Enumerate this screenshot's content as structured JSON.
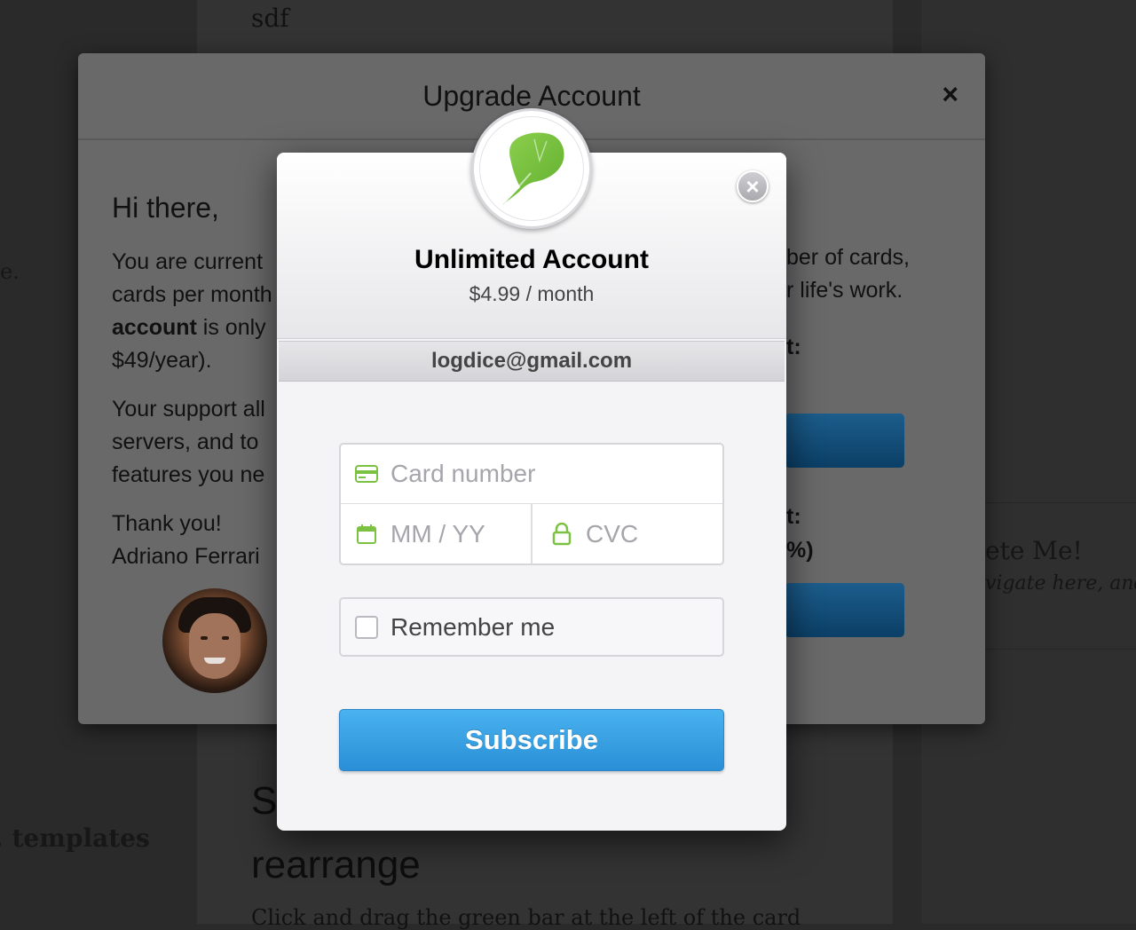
{
  "background": {
    "top_text": "sdf",
    "left_fragment": "e.",
    "left_bottom_fragment": ", templates",
    "heading_line1": "S",
    "heading_line2": "rearrange",
    "paragraph": "Click and drag the green bar at the left of the card",
    "side_card_title": "ete Me!",
    "side_card_sub": "vigate here, and"
  },
  "upgrade_modal": {
    "title": "Upgrade Account",
    "close_label": "×",
    "greeting": "Hi there,",
    "para1_line1": "You are current",
    "para1_line2": "cards per month",
    "para1_line3_bold": "account",
    "para1_line3_rest": " is only",
    "para1_line4": "$49/year).",
    "para2_line1": "Your support all",
    "para2_line2": "servers, and to",
    "para2_line3": "features you ne",
    "thanks": "Thank you!",
    "signature": "Adriano Ferrari",
    "right_line1": "ber of cards,",
    "right_line2": "r life's work.",
    "right_label1": "t:",
    "right_label2": "t:",
    "right_label3": "%)"
  },
  "checkout": {
    "title": "Unlimited Account",
    "price": "$4.99 / month",
    "email": "logdice@gmail.com",
    "close_label": "×",
    "card_number_placeholder": "Card number",
    "expiry_placeholder": "MM / YY",
    "cvc_placeholder": "CVC",
    "remember_label": "Remember me",
    "remember_checked": false,
    "subscribe_label": "Subscribe",
    "accent_color": "#3aa3e6",
    "icon_color": "#7cc242"
  },
  "icons": {
    "logo": "ginkgo-leaf-icon",
    "card": "credit-card-icon",
    "calendar": "calendar-icon",
    "lock": "lock-icon",
    "close": "close-icon"
  }
}
